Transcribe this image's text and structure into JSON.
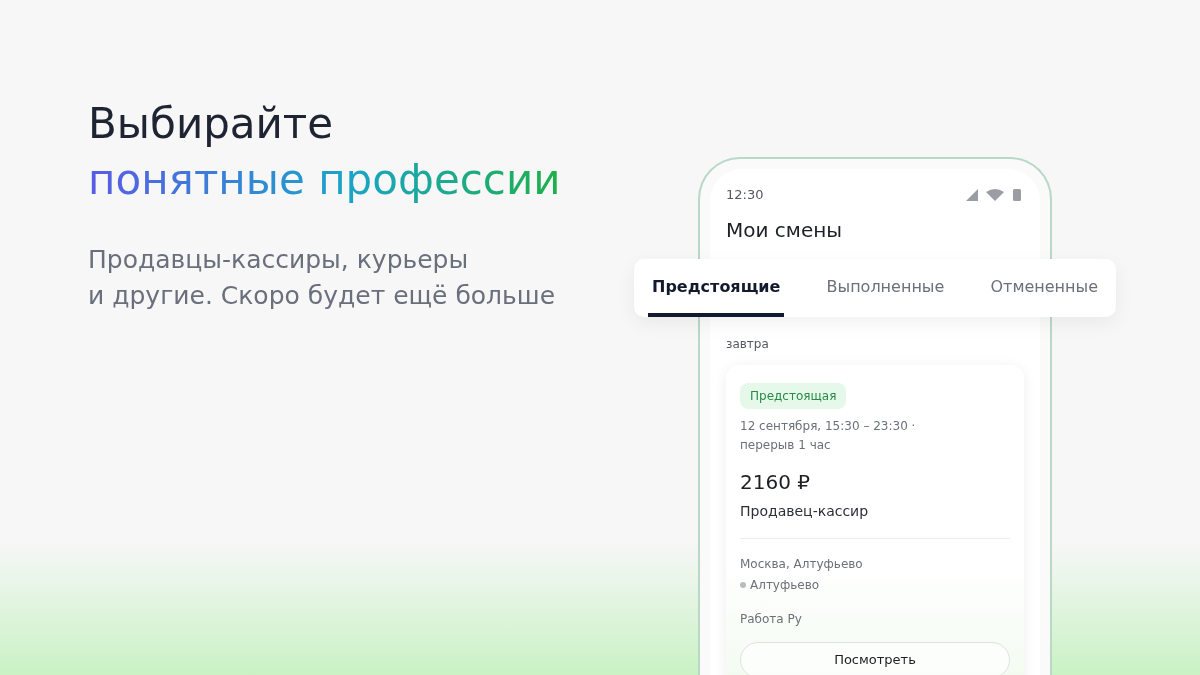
{
  "headline": {
    "line1": "Выбирайте",
    "line2": "понятные профессии"
  },
  "subtitle": [
    "Продавцы-кассиры, курьеры",
    "и другие. Скоро будет ещё больше"
  ],
  "phone": {
    "status_bar": {
      "time": "12:30"
    },
    "title": "Мои смены",
    "tabs": [
      {
        "label": "Предстоящие",
        "selected": true
      },
      {
        "label": "Выполненные",
        "selected": false
      },
      {
        "label": "Отмененные",
        "selected": false
      }
    ],
    "section_label": "завтра",
    "card": {
      "badge": "Предстоящая",
      "schedule": [
        "12 сентября, 15:30 – 23:30 ·",
        "перерыв 1 час"
      ],
      "pay": "2160 ₽",
      "role": "Продавец-кассир",
      "address": "Москва, Алтуфьево",
      "metro": "Алтуфьево",
      "employer": "Работа Ру",
      "button": "Посмотреть"
    }
  }
}
